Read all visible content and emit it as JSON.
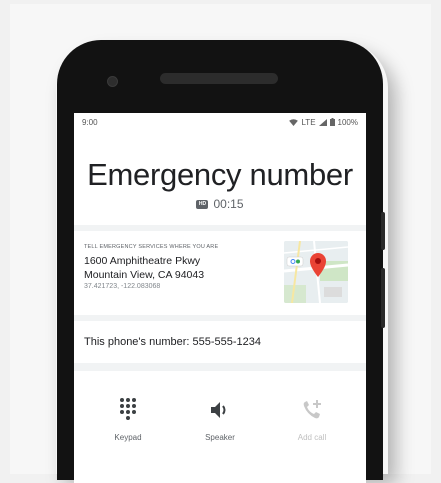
{
  "status_bar": {
    "time": "9:00",
    "network": "LTE",
    "battery": "100%"
  },
  "call": {
    "title": "Emergency number",
    "timer": "00:15"
  },
  "location": {
    "header": "TELL EMERGENCY SERVICES WHERE YOU ARE",
    "address_line1": "1600 Amphitheatre Pkwy",
    "address_line2": "Mountain View, CA 94043",
    "coordinates": "37.421723, -122.083068"
  },
  "phone_number": {
    "text": "This phone's number: 555-555-1234"
  },
  "actions": [
    {
      "label": "Keypad",
      "icon": "dialpad-icon",
      "enabled": true
    },
    {
      "label": "Speaker",
      "icon": "speaker-icon",
      "enabled": true
    },
    {
      "label": "Add call",
      "icon": "add-call-icon",
      "enabled": false
    }
  ],
  "colors": {
    "map_pin": "#ea4335",
    "text_primary": "#202124",
    "text_secondary": "#5f6368",
    "disabled": "#c0c0c0"
  }
}
